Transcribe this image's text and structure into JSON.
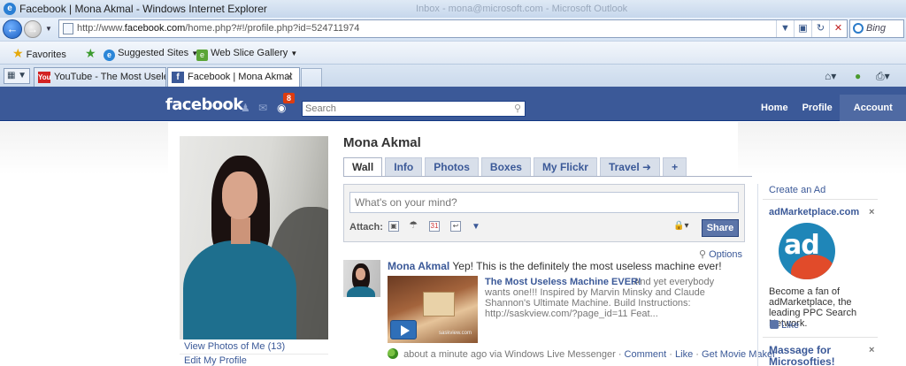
{
  "window": {
    "title": "Facebook | Mona Akmal - Windows Internet Explorer",
    "background_title": "Inbox - mona@microsoft.com - Microsoft Outlook"
  },
  "browser": {
    "url_prefix": "http://www.",
    "url_host": "facebook.com",
    "url_rest": "/home.php?#!/profile.php?id=524711974",
    "search_engine": "Bing",
    "favorites": {
      "favorites_label": "Favorites",
      "suggested_sites": "Suggested Sites",
      "web_slice_gallery": "Web Slice Gallery"
    },
    "tabs": [
      {
        "label": "YouTube - The Most Usele...",
        "active": false
      },
      {
        "label": "Facebook | Mona Akmal",
        "active": true
      }
    ]
  },
  "fb_header": {
    "logo": "facebook",
    "notification_count": "8",
    "search_placeholder": "Search",
    "nav": {
      "home": "Home",
      "profile": "Profile",
      "account": "Account"
    }
  },
  "profile": {
    "name": "Mona Akmal",
    "links": [
      "View Photos of Me (13)",
      "Edit My Profile"
    ],
    "tabs": [
      "Wall",
      "Info",
      "Photos",
      "Boxes",
      "My Flickr",
      "Travel",
      "+"
    ],
    "active_tab": "Wall"
  },
  "composer": {
    "placeholder": "What's on your mind?",
    "attach_label": "Attach:",
    "share_label": "Share"
  },
  "feed": {
    "options_label": "Options",
    "story": {
      "author": "Mona Akmal",
      "text": "Yep! This is the definitely the most useless machine ever!",
      "video_title": "The Most Useless Machine EVER!",
      "video_desc": "And yet everybody wants one!!! Inspired by Marvin Minsky and Claude Shannon's Ultimate Machine. Build Instructions: http://saskview.com/?page_id=11 Feat...",
      "thumb_watermark": "saskview.com",
      "time": "about a minute ago via Windows Live Messenger",
      "comment": "Comment",
      "like": "Like",
      "movie_maker": "Get Movie Maker",
      "sep": "·"
    }
  },
  "ads": {
    "create_ad": "Create an Ad",
    "ad1": {
      "title": "adMarketplace.com",
      "logo_text": "ad",
      "body": "Become a fan of adMarketplace, the leading PPC Search Network.",
      "like": "Like"
    },
    "ad2": {
      "title": "Massage for Microsofties!"
    },
    "close": "×"
  },
  "colors": {
    "fb_blue": "#3b5998",
    "fb_dark_blue": "#133783",
    "notification_red": "#dd3c10"
  }
}
